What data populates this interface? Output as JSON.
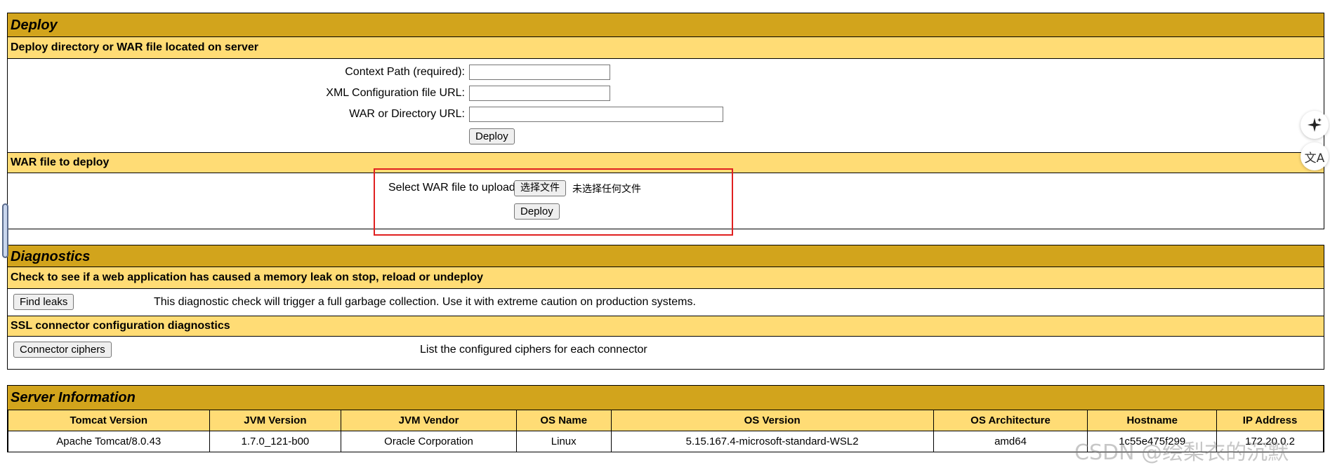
{
  "deploy": {
    "title": "Deploy",
    "server_section": {
      "title": "Deploy directory or WAR file located on server",
      "context_path_label": "Context Path (required):",
      "context_path_value": "",
      "xml_config_label": "XML Configuration file URL:",
      "xml_config_value": "",
      "war_dir_label": "WAR or Directory URL:",
      "war_dir_value": "",
      "deploy_button": "Deploy"
    },
    "war_section": {
      "title": "WAR file to deploy",
      "select_label": "Select WAR file to upload",
      "choose_file_button": "选择文件",
      "no_file_text": "未选择任何文件",
      "deploy_button": "Deploy"
    }
  },
  "diagnostics": {
    "title": "Diagnostics",
    "leak_section": {
      "title": "Check to see if a web application has caused a memory leak on stop, reload or undeploy",
      "button": "Find leaks",
      "description": "This diagnostic check will trigger a full garbage collection. Use it with extreme caution on production systems."
    },
    "ssl_section": {
      "title": "SSL connector configuration diagnostics",
      "button": "Connector ciphers",
      "description": "List the configured ciphers for each connector"
    }
  },
  "server_info": {
    "title": "Server Information",
    "headers": [
      "Tomcat Version",
      "JVM Version",
      "JVM Vendor",
      "OS Name",
      "OS Version",
      "OS Architecture",
      "Hostname",
      "IP Address"
    ],
    "values": [
      "Apache Tomcat/8.0.43",
      "1.7.0_121-b00",
      "Oracle Corporation",
      "Linux",
      "5.15.167.4-microsoft-standard-WSL2",
      "amd64",
      "1c55e475f299",
      "172.20.0.2"
    ]
  },
  "side_icons": [
    "sparkle-icon",
    "translate-icon"
  ],
  "watermark": "CSDN @绘梨衣的沉默",
  "colors": {
    "header_dark": "#D2A41C",
    "header_light": "#FFDC75",
    "highlight_box": "#e02020"
  }
}
